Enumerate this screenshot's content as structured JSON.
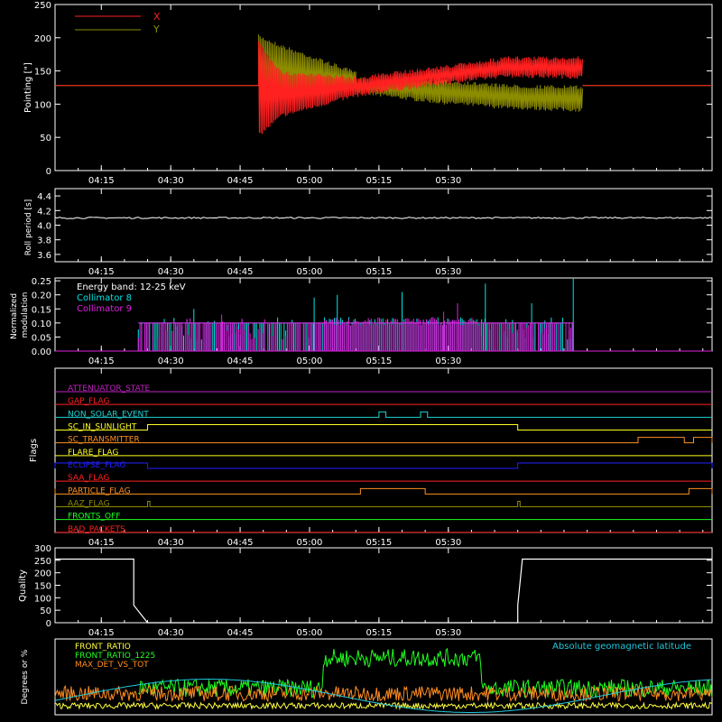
{
  "time_ticks": [
    "04:15",
    "04:30",
    "04:45",
    "05:00",
    "05:15",
    "05:30"
  ],
  "colors": {
    "axis": "#ffffff",
    "x_series": "#ff2020",
    "y_series": "#8c8c00",
    "collimator8": "#00e5e5",
    "collimator9": "#e020e0",
    "front_ratio": "#ffff40",
    "front_ratio_1225": "#20ff20",
    "max_det": "#ff8c20",
    "geomag": "#20c8dc"
  },
  "chart_data": [
    {
      "type": "line",
      "ylabel": "Pointing [\"]",
      "ylim": [
        0,
        250
      ],
      "yticks": [
        "0",
        "50",
        "100",
        "150",
        "200",
        "250"
      ],
      "series": [
        {
          "name": "X",
          "segments": [
            {
              "t": [
                0,
                44
              ],
              "v": 128
            },
            {
              "t": [
                44,
                49
              ],
              "lo": [
                50,
                80
              ],
              "hi": [
                195,
                150
              ]
            },
            {
              "t": [
                49,
                65
              ],
              "lo": [
                80,
                110
              ],
              "hi": [
                150,
                142
              ]
            },
            {
              "t": [
                65,
                83
              ],
              "lo": [
                110,
                128
              ],
              "hi": [
                142,
                158
              ]
            },
            {
              "t": [
                83,
                98
              ],
              "lo": [
                128,
                140
              ],
              "hi": [
                158,
                172
              ]
            },
            {
              "t": [
                98,
                114
              ],
              "lo": [
                140,
                138
              ],
              "hi": [
                172,
                172
              ]
            },
            {
              "t": [
                114,
                142
              ],
              "v": 128
            }
          ]
        },
        {
          "name": "Y",
          "segments": [
            {
              "t": [
                0,
                44
              ],
              "v": 128
            },
            {
              "t": [
                44,
                49
              ],
              "lo": [
                95,
                108
              ],
              "hi": [
                205,
                190
              ]
            },
            {
              "t": [
                49,
                65
              ],
              "lo": [
                108,
                125
              ],
              "hi": [
                190,
                150
              ]
            },
            {
              "t": [
                65,
                83
              ],
              "lo": [
                115,
                100
              ],
              "hi": [
                140,
                138
              ]
            },
            {
              "t": [
                83,
                98
              ],
              "lo": [
                100,
                92
              ],
              "hi": [
                138,
                130
              ]
            },
            {
              "t": [
                98,
                114
              ],
              "lo": [
                92,
                88
              ],
              "hi": [
                130,
                128
              ]
            },
            {
              "t": [
                114,
                142
              ],
              "v": 128
            }
          ]
        }
      ]
    },
    {
      "type": "line",
      "ylabel": "Roll period [s]",
      "ylim": [
        3.5,
        4.5
      ],
      "yticks": [
        "3.6",
        "3.8",
        "4.0",
        "4.2",
        "4.4"
      ],
      "series": [
        {
          "name": "",
          "constant": 4.1,
          "t_range": [
            0,
            142
          ]
        }
      ]
    },
    {
      "type": "bar",
      "ylabel": "Normalized modulation",
      "ylim": [
        0,
        0.26
      ],
      "yticks": [
        "0.00",
        "0.05",
        "0.10",
        "0.15",
        "0.20",
        "0.25"
      ],
      "annotation": "Energy band: 12-25 keV",
      "series": [
        {
          "name": "Collimator 8",
          "t_range": [
            18,
            112
          ],
          "typical": 0.1,
          "spikes": [
            [
              30,
              0.15
            ],
            [
              56,
              0.19
            ],
            [
              61,
              0.2
            ],
            [
              75,
              0.21
            ],
            [
              93,
              0.24
            ],
            [
              103,
              0.17
            ],
            [
              112,
              0.26
            ]
          ]
        },
        {
          "name": "Collimator 9",
          "t_range": [
            18,
            112
          ],
          "typical": 0.1,
          "spikes": [
            [
              36,
              0.13
            ],
            [
              84,
              0.14
            ],
            [
              87,
              0.17
            ]
          ]
        }
      ]
    },
    {
      "type": "line",
      "ylabel": "Flags",
      "flags": [
        {
          "name": "ATTENUATOR_STATE",
          "color": "#c020c0",
          "steps": []
        },
        {
          "name": "GAP_FLAG",
          "color": "#ff2020",
          "steps": []
        },
        {
          "name": "NON_SOLAR_EVENT",
          "color": "#20d0d0",
          "steps": [
            [
              70,
              71.5
            ],
            [
              79,
              80.5
            ]
          ]
        },
        {
          "name": "SC_IN_SUNLIGHT",
          "color": "#ffff20",
          "steps": [
            [
              20,
              100
            ]
          ],
          "level_high": true
        },
        {
          "name": "SC_TRANSMITTER",
          "color": "#ff9020",
          "steps": [
            [
              126,
              136
            ],
            [
              138,
              142
            ]
          ]
        },
        {
          "name": "FLARE_FLAG",
          "color": "#ffff20",
          "steps": []
        },
        {
          "name": "ECLIPSE_FLAG",
          "color": "#2020ff",
          "steps": [
            [
              0,
              20
            ],
            [
              100,
              142
            ]
          ]
        },
        {
          "name": "SAA_FLAG",
          "color": "#ff2020",
          "steps": []
        },
        {
          "name": "PARTICLE_FLAG",
          "color": "#ff9020",
          "steps": [
            [
              -1,
              0
            ],
            [
              66,
              80
            ],
            [
              137,
              142
            ]
          ]
        },
        {
          "name": "AAZ_FLAG",
          "color": "#8c8c00",
          "steps": [
            [
              20,
              20.5
            ],
            [
              100,
              100.5
            ]
          ]
        },
        {
          "name": "FRONTS_OFF",
          "color": "#20ff20",
          "steps": []
        },
        {
          "name": "BAD_PACKETS",
          "color": "#ff2020",
          "steps": []
        }
      ]
    },
    {
      "type": "line",
      "ylabel": "Quality",
      "ylim": [
        0,
        300
      ],
      "yticks": [
        "0",
        "50",
        "100",
        "150",
        "200",
        "250",
        "300"
      ],
      "series": [
        {
          "name": "",
          "points": [
            [
              0,
              255
            ],
            [
              17,
              255
            ],
            [
              17,
              70
            ],
            [
              20,
              0
            ],
            [
              100,
              0
            ],
            [
              100,
              70
            ],
            [
              101,
              255
            ],
            [
              142,
              255
            ]
          ]
        }
      ]
    },
    {
      "type": "line",
      "ylabel": "Degrees or %",
      "ylim": [
        0,
        100
      ],
      "legend": [
        "FRONT_RATIO",
        "FRONT_RATIO_1225",
        "MAX_DET_VS_TOT"
      ],
      "annotation": "Absolute geomagnetic latitude",
      "series": [
        {
          "name": "FRONT_RATIO",
          "base": 12,
          "noise": 4,
          "t_range": [
            0,
            142
          ]
        },
        {
          "name": "FRONT_RATIO_1225",
          "base": 35,
          "noise": 12,
          "t_range": [
            18,
            142
          ],
          "high": {
            "t": [
              58,
              92
            ],
            "base": 75
          }
        },
        {
          "name": "MAX_DET_VS_TOT",
          "base": 28,
          "noise": 10,
          "t_range": [
            0,
            142
          ]
        },
        {
          "name": "Absolute geomagnetic latitude",
          "wave": true
        }
      ]
    }
  ]
}
